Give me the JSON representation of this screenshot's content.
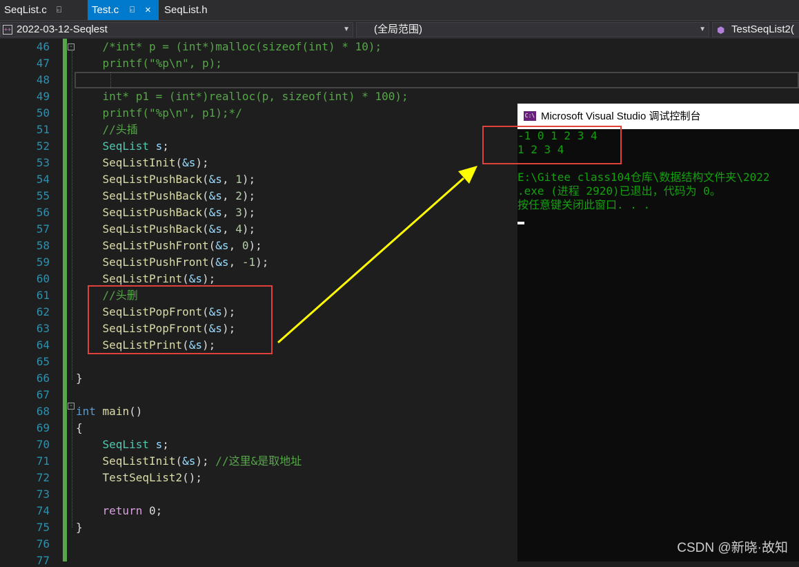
{
  "tabs": [
    {
      "label": "SeqList.c",
      "pin": "⍇"
    },
    {
      "label": "Test.c",
      "pin": "⍇",
      "close": "×"
    },
    {
      "label": "SeqList.h"
    }
  ],
  "navbar": {
    "project": "2022-03-12-Seqlest",
    "scope": "(全局范围)",
    "member": "TestSeqList2("
  },
  "icons": {
    "pin": "pin-icon",
    "close": "close-icon",
    "dropdown": "chevron-down-icon",
    "project": "cpp-project-icon",
    "member": "cube-icon"
  },
  "editor": {
    "line_numbers": [
      "46",
      "47",
      "48",
      "49",
      "50",
      "51",
      "52",
      "53",
      "54",
      "55",
      "56",
      "57",
      "58",
      "59",
      "60",
      "61",
      "62",
      "63",
      "64",
      "65",
      "66",
      "67",
      "68",
      "69",
      "70",
      "71",
      "72",
      "73",
      "74",
      "75",
      "76",
      "77"
    ],
    "line_46": "    /*int* p = (int*)malloc(sizeof(int) * 10);",
    "line_47": "    printf(\"%p\\n\", p);",
    "line_49": "    int* p1 = (int*)realloc(p, sizeof(int) * 100);",
    "line_50": "    printf(\"%p\\n\", p1);*/",
    "line_51": "    //头插",
    "l52_type": "SeqList",
    "l52_var": "s",
    "semi": ";",
    "l53_fn": "SeqListInit",
    "amp_s": "&s",
    "close_paren_semi": ");",
    "open_paren": "(",
    "fn_pushback": "SeqListPushBack",
    "fn_pushfront": "SeqListPushFront",
    "fn_print": "SeqListPrint",
    "fn_popfront": "SeqListPopFront",
    "arg_sep": ", ",
    "num_1": "1",
    "num_2": "2",
    "num_3": "3",
    "num_4": "4",
    "num_0": "0",
    "num_m1": "-1",
    "line_61": "    //头删",
    "close_brace": "}",
    "open_brace": "{",
    "kw_int": "int",
    "fn_main": "main",
    "empty_parens": "()",
    "line_71_comment": " //这里&是取地址",
    "fn_test": "TestSeqList2",
    "empty_call": "();",
    "kw_return": "return",
    "ret_val": " 0;",
    "indent": "    ",
    "space": " "
  },
  "console": {
    "title": "Microsoft Visual Studio 调试控制台",
    "icon_text": "C:\\",
    "lines": [
      "-1 0 1 2 3 4",
      "1 2 3 4",
      "",
      "E:\\Gitee class104仓库\\数据结构文件夹\\2022",
      ".exe (进程 2920)已退出，代码为 0。",
      "按任意键关闭此窗口. . ."
    ]
  },
  "watermark": "CSDN @新晓·故知",
  "colors": {
    "accent": "#007acc",
    "annotation_box": "#e0413a",
    "annotation_arrow": "#ffff00",
    "console_text": "#13a10e"
  }
}
